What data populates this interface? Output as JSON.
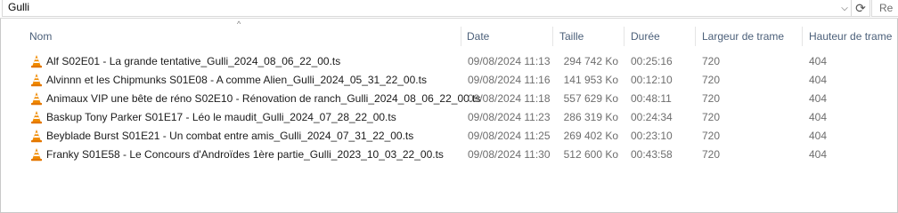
{
  "address": {
    "path": "Gulli",
    "search_placeholder": "Re"
  },
  "columns": {
    "name": "Nom",
    "date": "Date",
    "size": "Taille",
    "duration": "Durée",
    "frame_width": "Largeur de trame",
    "frame_height": "Hauteur de trame"
  },
  "sort": {
    "column": "Nom",
    "direction": "ascending"
  },
  "files": [
    {
      "name": "Alf S02E01 - La grande tentative_Gulli_2024_08_06_22_00.ts",
      "date": "09/08/2024 11:13",
      "size": "294 742 Ko",
      "duration": "00:25:16",
      "frame_width": "720",
      "frame_height": "404"
    },
    {
      "name": "Alvinnn et les Chipmunks S01E08 - A comme Alien_Gulli_2024_05_31_22_00.ts",
      "date": "09/08/2024 11:16",
      "size": "141 953 Ko",
      "duration": "00:12:10",
      "frame_width": "720",
      "frame_height": "404"
    },
    {
      "name": "Animaux VIP une bête de réno S02E10 - Rénovation de ranch_Gulli_2024_08_06_22_00.ts",
      "date": "09/08/2024 11:18",
      "size": "557 629 Ko",
      "duration": "00:48:11",
      "frame_width": "720",
      "frame_height": "404"
    },
    {
      "name": "Baskup Tony Parker S01E17 - Léo le maudit_Gulli_2024_07_28_22_00.ts",
      "date": "09/08/2024 11:23",
      "size": "286 319 Ko",
      "duration": "00:24:34",
      "frame_width": "720",
      "frame_height": "404"
    },
    {
      "name": "Beyblade Burst S01E21 - Un combat entre amis_Gulli_2024_07_31_22_00.ts",
      "date": "09/08/2024 11:25",
      "size": "269 402 Ko",
      "duration": "00:23:10",
      "frame_width": "720",
      "frame_height": "404"
    },
    {
      "name": "Franky S01E58 - Le Concours d'Androïdes 1ère partie_Gulli_2023_10_03_22_00.ts",
      "date": "09/08/2024 11:30",
      "size": "512 600 Ko",
      "duration": "00:43:58",
      "frame_width": "720",
      "frame_height": "404"
    }
  ],
  "icons": {
    "file": "vlc-cone-icon",
    "refresh": "refresh-icon",
    "dropdown": "chevron-down-icon"
  },
  "colors": {
    "header_text": "#4c607a",
    "vlc_orange": "#f08a00"
  }
}
